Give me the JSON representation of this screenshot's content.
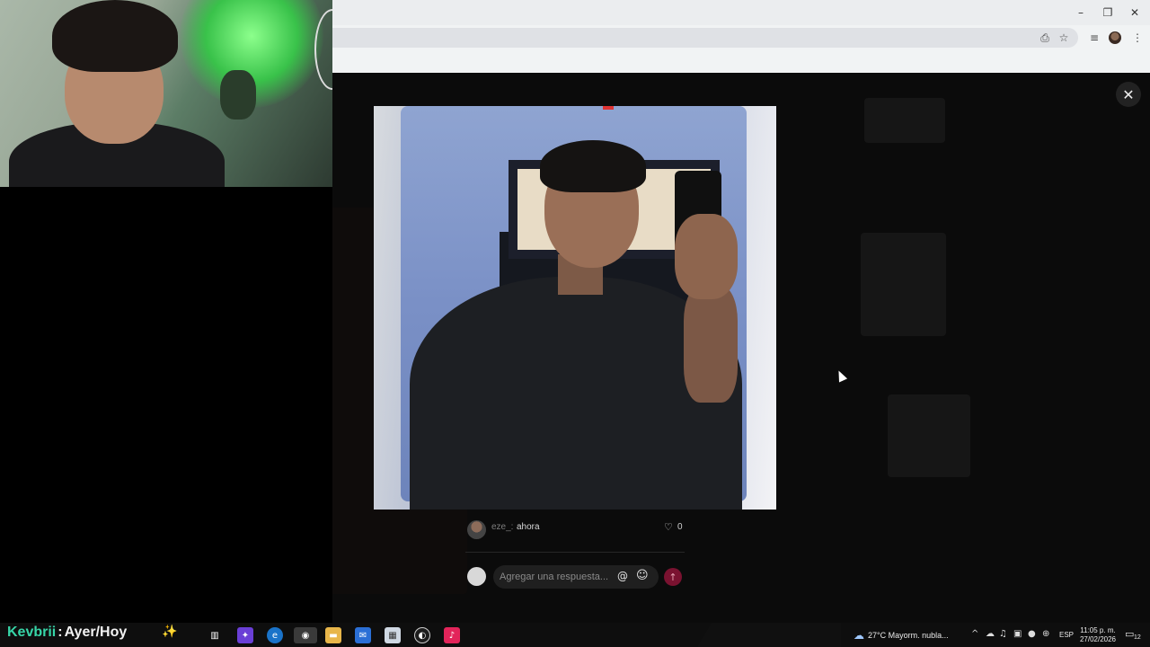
{
  "browser": {
    "window_controls": {
      "minimize": "–",
      "restore": "❐",
      "close": "✕"
    },
    "toolbar_icons": [
      "install-icon",
      "star-icon",
      "media-icon",
      "profile-avatar",
      "kebab-menu-icon"
    ]
  },
  "webcam": {
    "description_icon": "webcam-feed"
  },
  "modal": {
    "close_icon": "✕",
    "author": {
      "name": "eze_: ",
      "time": "ahora"
    },
    "likes": {
      "icon": "♡",
      "count": "0"
    },
    "reply": {
      "placeholder": "Agregar una respuesta...",
      "mention_icon": "@",
      "emoji_icon": "☺",
      "send_icon": "↑"
    }
  },
  "stream_overlay": {
    "name": "Kevbrii",
    "separator": " : ",
    "title": "Ayer/Hoy",
    "sparkle": "✨"
  },
  "taskbar": {
    "weather": {
      "icon": "☁",
      "text": "27°C  Mayorm. nubla..."
    },
    "language": "ESP",
    "clock": {
      "time": "11:05 p. m.",
      "date": "27/02/2026"
    },
    "notifications": {
      "icon": "▭",
      "count": "12"
    },
    "colors": {
      "send_bg": "#7a1230",
      "stream_name": "#37d6a8"
    }
  }
}
